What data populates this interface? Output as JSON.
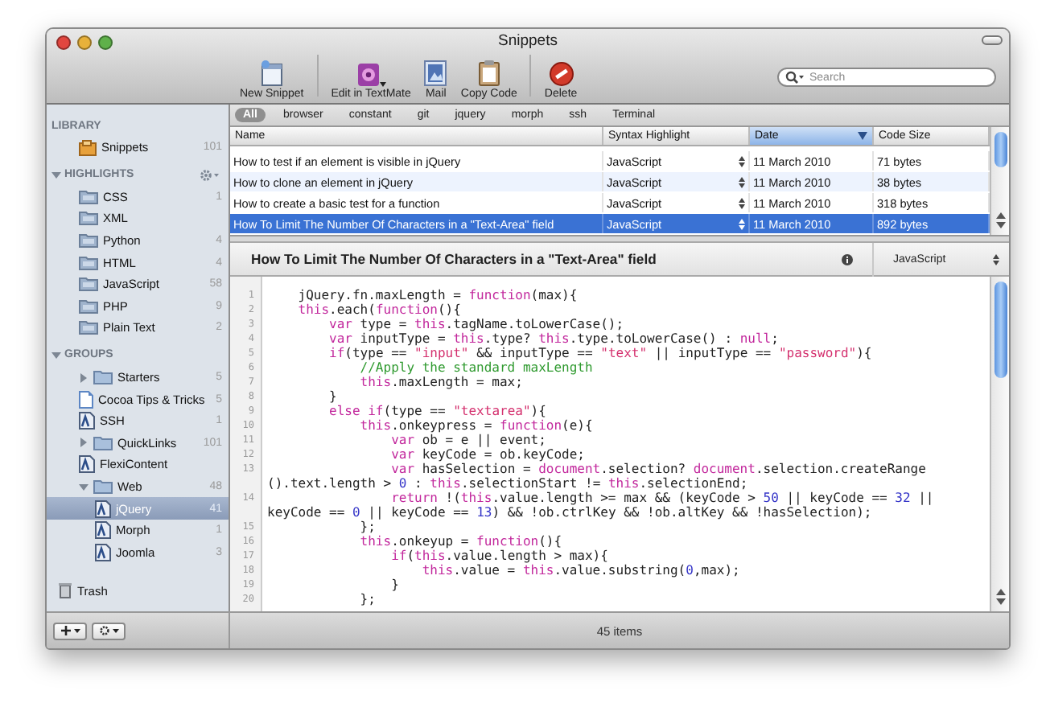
{
  "window": {
    "title": "Snippets"
  },
  "toolbar": [
    {
      "label": "New Snippet",
      "dropdown": false
    },
    {
      "label": "Edit in TextMate",
      "dropdown": true
    },
    {
      "label": "Mail",
      "dropdown": false
    },
    {
      "label": "Copy Code",
      "dropdown": false
    },
    {
      "label": "Delete",
      "dropdown": false
    }
  ],
  "search": {
    "placeholder": "Search"
  },
  "sidebar": {
    "sections": [
      {
        "heading": "LIBRARY",
        "items": [
          {
            "label": "Snippets",
            "count": "101",
            "kind": "library",
            "selected": false
          }
        ]
      },
      {
        "heading": "HIGHLIGHTS",
        "expanded": true,
        "has_menu": true,
        "items": [
          {
            "label": "CSS",
            "count": "1",
            "kind": "smartfolder",
            "selected": false
          },
          {
            "label": "XML",
            "kind": "smartfolder",
            "selected": false
          },
          {
            "label": "Python",
            "count": "4",
            "kind": "smartfolder",
            "selected": false
          },
          {
            "label": "HTML",
            "count": "4",
            "kind": "smartfolder",
            "selected": false
          },
          {
            "label": "JavaScript",
            "count": "58",
            "kind": "smartfolder",
            "selected": false
          },
          {
            "label": "PHP",
            "count": "9",
            "kind": "smartfolder",
            "selected": false
          },
          {
            "label": "Plain Text",
            "count": "2",
            "kind": "smartfolder",
            "selected": false
          }
        ]
      },
      {
        "heading": "GROUPS",
        "expanded": true,
        "items": [
          {
            "label": "Starters",
            "count": "5",
            "kind": "folder",
            "selected": false,
            "expanded": false
          },
          {
            "label": "Cocoa Tips & Tricks",
            "count": "5",
            "kind": "document",
            "selected": false
          },
          {
            "label": "SSH",
            "count": "1",
            "kind": "snippet",
            "selected": false
          },
          {
            "label": "QuickLinks",
            "count": "101",
            "kind": "folder",
            "selected": false,
            "expanded": false
          },
          {
            "label": "FlexiContent",
            "kind": "snippet",
            "selected": false
          },
          {
            "label": "Web",
            "count": "48",
            "kind": "folder",
            "selected": false,
            "expanded": true,
            "children": [
              {
                "label": "jQuery",
                "count": "41",
                "kind": "snippet",
                "selected": true
              },
              {
                "label": "Morph",
                "count": "1",
                "kind": "snippet",
                "selected": false
              },
              {
                "label": "Joomla",
                "count": "3",
                "kind": "snippet",
                "selected": false
              }
            ]
          }
        ]
      }
    ],
    "trash": {
      "label": "Trash"
    }
  },
  "tags": [
    {
      "label": "All",
      "selected": true
    },
    {
      "label": "browser",
      "selected": false
    },
    {
      "label": "constant",
      "selected": false
    },
    {
      "label": "git",
      "selected": false
    },
    {
      "label": "jquery",
      "selected": false
    },
    {
      "label": "morph",
      "selected": false
    },
    {
      "label": "ssh",
      "selected": false
    },
    {
      "label": "Terminal",
      "selected": false
    }
  ],
  "table": {
    "columns": [
      {
        "label": "Name",
        "sorted": false
      },
      {
        "label": "Syntax Highlight",
        "sorted": false
      },
      {
        "label": "Date",
        "sorted": true
      },
      {
        "label": "Code Size",
        "sorted": false
      }
    ],
    "rows": [
      {
        "selected": false,
        "cells": [
          "How to test if an element is visible in jQuery",
          "JavaScript",
          "11 March 2010",
          "71 bytes"
        ]
      },
      {
        "selected": false,
        "cells": [
          "How to clone an element in jQuery",
          "JavaScript",
          "11 March 2010",
          "38 bytes"
        ]
      },
      {
        "selected": false,
        "cells": [
          "How to create a basic test for a function",
          "JavaScript",
          "11 March 2010",
          "318 bytes"
        ]
      },
      {
        "selected": true,
        "cells": [
          "How To Limit The Number Of Characters in a \"Text-Area\" field",
          "JavaScript",
          "11 March 2010",
          "892 bytes"
        ]
      }
    ]
  },
  "detail": {
    "title": "How To Limit The Number Of Characters in a \"Text-Area\" field",
    "syntax": "JavaScript",
    "code": [
      {
        "number": "1",
        "tokens": [
          {
            "kind": "plain",
            "text": "    jQuery.fn.maxLength = "
          },
          {
            "kind": "keyword",
            "text": "function"
          },
          {
            "kind": "plain",
            "text": "(max){"
          }
        ]
      },
      {
        "number": "2",
        "tokens": [
          {
            "kind": "keyword",
            "text": "    this"
          },
          {
            "kind": "plain",
            "text": ".each("
          },
          {
            "kind": "keyword",
            "text": "function"
          },
          {
            "kind": "plain",
            "text": "(){"
          }
        ]
      },
      {
        "number": "3",
        "tokens": [
          {
            "kind": "keyword",
            "text": "        var"
          },
          {
            "kind": "plain",
            "text": " type = "
          },
          {
            "kind": "keyword",
            "text": "this"
          },
          {
            "kind": "plain",
            "text": ".tagName.toLowerCase();"
          }
        ]
      },
      {
        "number": "4",
        "tokens": [
          {
            "kind": "keyword",
            "text": "        var"
          },
          {
            "kind": "plain",
            "text": " inputType = "
          },
          {
            "kind": "keyword",
            "text": "this"
          },
          {
            "kind": "plain",
            "text": ".type? "
          },
          {
            "kind": "keyword",
            "text": "this"
          },
          {
            "kind": "plain",
            "text": ".type.toLowerCase() : "
          },
          {
            "kind": "keyword",
            "text": "null"
          },
          {
            "kind": "plain",
            "text": ";"
          }
        ]
      },
      {
        "number": "5",
        "tokens": [
          {
            "kind": "keyword",
            "text": "        if"
          },
          {
            "kind": "plain",
            "text": "(type == "
          },
          {
            "kind": "string",
            "text": "\"input\""
          },
          {
            "kind": "plain",
            "text": " && inputType == "
          },
          {
            "kind": "string",
            "text": "\"text\""
          },
          {
            "kind": "plain",
            "text": " || inputType == "
          },
          {
            "kind": "string",
            "text": "\"password\""
          },
          {
            "kind": "plain",
            "text": "){"
          }
        ]
      },
      {
        "number": "6",
        "tokens": [
          {
            "kind": "comment",
            "text": "            //Apply the standard maxLength"
          }
        ]
      },
      {
        "number": "7",
        "tokens": [
          {
            "kind": "keyword",
            "text": "            this"
          },
          {
            "kind": "plain",
            "text": ".maxLength = max;"
          }
        ]
      },
      {
        "number": "8",
        "tokens": [
          {
            "kind": "plain",
            "text": "        }"
          }
        ]
      },
      {
        "number": "9",
        "tokens": [
          {
            "kind": "keyword",
            "text": "        else if"
          },
          {
            "kind": "plain",
            "text": "(type == "
          },
          {
            "kind": "string",
            "text": "\"textarea\""
          },
          {
            "kind": "plain",
            "text": "){"
          }
        ]
      },
      {
        "number": "10",
        "tokens": [
          {
            "kind": "keyword",
            "text": "            this"
          },
          {
            "kind": "plain",
            "text": ".onkeypress = "
          },
          {
            "kind": "keyword",
            "text": "function"
          },
          {
            "kind": "plain",
            "text": "(e){"
          }
        ]
      },
      {
        "number": "11",
        "tokens": [
          {
            "kind": "keyword",
            "text": "                var"
          },
          {
            "kind": "plain",
            "text": " ob = e || event;"
          }
        ]
      },
      {
        "number": "12",
        "tokens": [
          {
            "kind": "keyword",
            "text": "                var"
          },
          {
            "kind": "plain",
            "text": " keyCode = ob.keyCode;"
          }
        ]
      },
      {
        "number": "13",
        "tokens": [
          {
            "kind": "keyword",
            "text": "                var"
          },
          {
            "kind": "plain",
            "text": " hasSelection = "
          },
          {
            "kind": "keyword",
            "text": "document"
          },
          {
            "kind": "plain",
            "text": ".selection? "
          },
          {
            "kind": "keyword",
            "text": "document"
          },
          {
            "kind": "plain",
            "text": ".selection.createRange"
          }
        ]
      },
      {
        "tokens": [
          {
            "kind": "plain",
            "text": "().text.length > "
          },
          {
            "kind": "number",
            "text": "0"
          },
          {
            "kind": "plain",
            "text": " : "
          },
          {
            "kind": "keyword",
            "text": "this"
          },
          {
            "kind": "plain",
            "text": ".selectionStart != "
          },
          {
            "kind": "keyword",
            "text": "this"
          },
          {
            "kind": "plain",
            "text": ".selectionEnd;"
          }
        ]
      },
      {
        "number": "14",
        "tokens": [
          {
            "kind": "keyword",
            "text": "                return"
          },
          {
            "kind": "plain",
            "text": " !("
          },
          {
            "kind": "keyword",
            "text": "this"
          },
          {
            "kind": "plain",
            "text": ".value.length >= max && (keyCode > "
          },
          {
            "kind": "number",
            "text": "50"
          },
          {
            "kind": "plain",
            "text": " || keyCode == "
          },
          {
            "kind": "number",
            "text": "32"
          },
          {
            "kind": "plain",
            "text": " ||"
          }
        ]
      },
      {
        "tokens": [
          {
            "kind": "plain",
            "text": "keyCode == "
          },
          {
            "kind": "number",
            "text": "0"
          },
          {
            "kind": "plain",
            "text": " || keyCode == "
          },
          {
            "kind": "number",
            "text": "13"
          },
          {
            "kind": "plain",
            "text": ") && !ob.ctrlKey && !ob.altKey && !hasSelection);"
          }
        ]
      },
      {
        "number": "15",
        "tokens": [
          {
            "kind": "plain",
            "text": "            };"
          }
        ]
      },
      {
        "number": "16",
        "tokens": [
          {
            "kind": "keyword",
            "text": "            this"
          },
          {
            "kind": "plain",
            "text": ".onkeyup = "
          },
          {
            "kind": "keyword",
            "text": "function"
          },
          {
            "kind": "plain",
            "text": "(){"
          }
        ]
      },
      {
        "number": "17",
        "tokens": [
          {
            "kind": "keyword",
            "text": "                if"
          },
          {
            "kind": "plain",
            "text": "("
          },
          {
            "kind": "keyword",
            "text": "this"
          },
          {
            "kind": "plain",
            "text": ".value.length > max){"
          }
        ]
      },
      {
        "number": "18",
        "tokens": [
          {
            "kind": "keyword",
            "text": "                    this"
          },
          {
            "kind": "plain",
            "text": ".value = "
          },
          {
            "kind": "keyword",
            "text": "this"
          },
          {
            "kind": "plain",
            "text": ".value.substring("
          },
          {
            "kind": "number",
            "text": "0"
          },
          {
            "kind": "plain",
            "text": ",max);"
          }
        ]
      },
      {
        "number": "19",
        "tokens": [
          {
            "kind": "plain",
            "text": "                }"
          }
        ]
      },
      {
        "number": "20",
        "tokens": [
          {
            "kind": "plain",
            "text": "            };"
          }
        ]
      }
    ]
  },
  "status_bar": {
    "text": "45 items"
  }
}
